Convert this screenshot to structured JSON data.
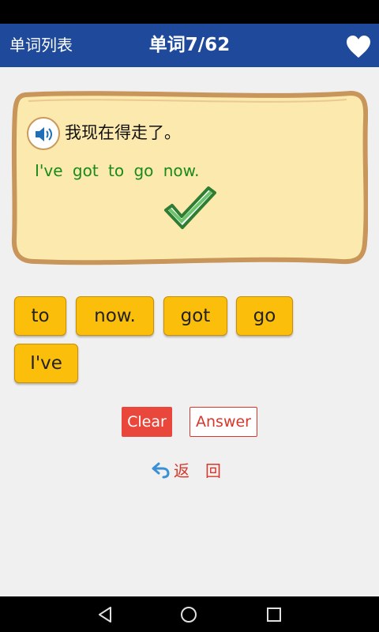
{
  "header": {
    "left_link": "单词列表",
    "title": "单词7/62",
    "favorite_icon": "heart-icon"
  },
  "card": {
    "speaker_icon": "speaker-icon",
    "prompt": "我现在得走了。",
    "sentence": "I've got to go now.",
    "result_icon": "checkmark-icon"
  },
  "word_tiles": [
    {
      "label": "to"
    },
    {
      "label": "now."
    },
    {
      "label": "got"
    },
    {
      "label": "go"
    },
    {
      "label": "I've"
    }
  ],
  "actions": {
    "clear_label": "Clear",
    "answer_label": "Answer"
  },
  "back": {
    "label": "返回",
    "icon": "undo-arrow-icon"
  },
  "nav": {
    "back_icon": "nav-back-icon",
    "home_icon": "nav-home-icon",
    "recents_icon": "nav-recents-icon"
  },
  "colors": {
    "header": "#1f4a9b",
    "tile": "#fbbe0b",
    "sentence": "#1b8a1b",
    "accent_red": "#e9473b",
    "card_fill": "#fbe9ad"
  }
}
